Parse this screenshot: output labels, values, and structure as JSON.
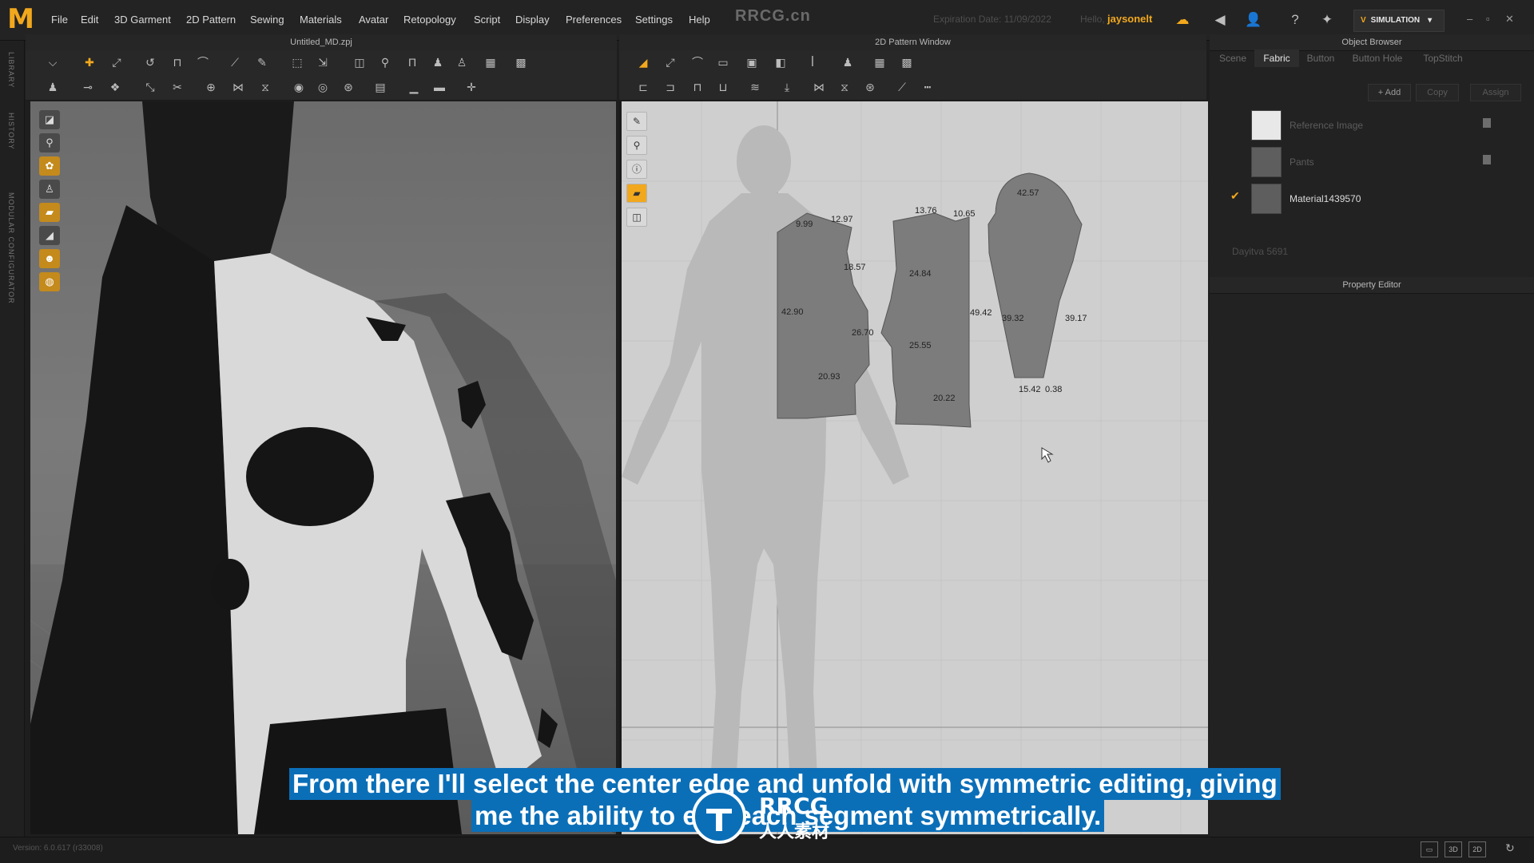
{
  "app": {
    "logo": "M",
    "watermark": "RRCG.cn",
    "menu": [
      "File",
      "Edit",
      "3D Garment",
      "2D Pattern",
      "Sewing",
      "Materials",
      "Avatar",
      "Retopology",
      "Script",
      "Display",
      "Preferences",
      "Settings",
      "Help"
    ],
    "expiry_label": "Expiration Date: 11/09/2022",
    "hello_label": "Hello,",
    "username": "jaysonelt",
    "simulation_label": "SIMULATION",
    "accent_color": "#f2a81d"
  },
  "left_strip": {
    "labels": [
      "LIBRARY",
      "HISTORY",
      "MODULAR CONFIGURATOR"
    ]
  },
  "viewport3d": {
    "title": "Untitled_MD.zpj"
  },
  "pattern_window": {
    "title": "2D Pattern Window",
    "front_piece": {
      "m1": "9.99",
      "m2": "12.97",
      "m3": "18.57",
      "m4": "42.90",
      "m5": "26.70",
      "m6": "20.93"
    },
    "back_piece": {
      "m1": "13.76",
      "m2": "10.65",
      "m3": "24.84",
      "m4": "49.42",
      "m5": "25.55",
      "m6": "20.22"
    },
    "sleeve": {
      "m1": "42.57",
      "m2": "39.32",
      "m3": "39.17",
      "m4": "15.42",
      "m5": "0.38"
    }
  },
  "object_browser": {
    "title": "Object Browser",
    "tabs": [
      "Scene",
      "Fabric",
      "Button",
      "Button Hole",
      "TopStitch"
    ],
    "active_tab": "Fabric",
    "add_label": "+ Add",
    "copy_label": "Copy",
    "assign_label": "Assign",
    "fabrics": [
      {
        "name": "Reference Image",
        "checked": false
      },
      {
        "name": "Pants",
        "checked": false
      },
      {
        "name": "Material1439570",
        "checked": true
      }
    ],
    "extra_item": "Dayitva 5691"
  },
  "property_editor": {
    "title": "Property Editor"
  },
  "status": {
    "version": "Version: 6.0.617 (r33008)"
  },
  "subtitle": {
    "line1": "From there I'll select the center edge and unfold with symmetric editing, giving",
    "line2": "me the ability to edit each segment symmetrically."
  },
  "overlay": {
    "brand": "RRCG",
    "brand_sub": "人人素材"
  }
}
